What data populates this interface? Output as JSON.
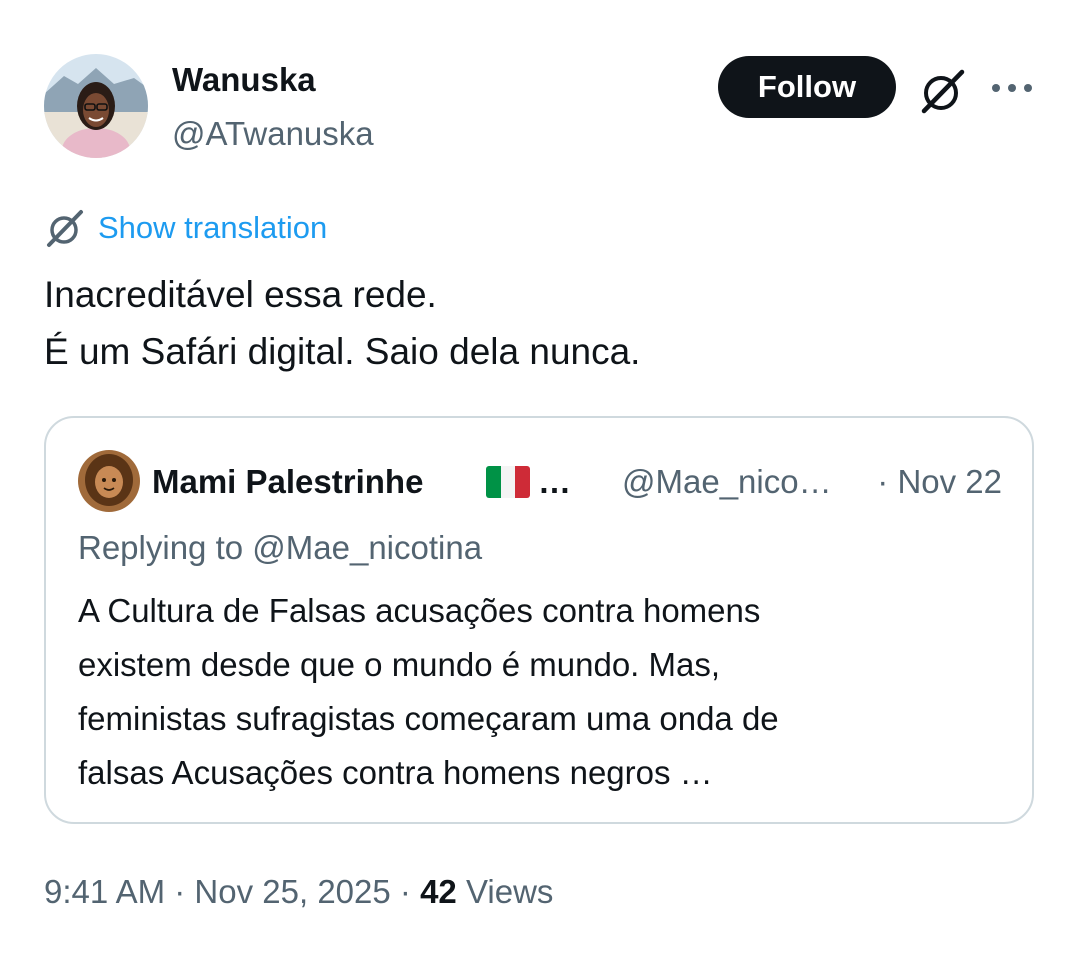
{
  "author": {
    "name": "Wanuska",
    "handle": "@ATwanuska",
    "avatar_icon": "profile-photo"
  },
  "actions": {
    "follow_label": "Follow",
    "grok_icon": "slashed-circle-icon",
    "more_icon": "more-dots-icon"
  },
  "translation": {
    "label": "Show translation",
    "icon": "slashed-circle-icon"
  },
  "tweet": {
    "lines": [
      "Inacreditável essa rede.",
      "É um Safári digital. Saio dela nunca."
    ]
  },
  "quoted_tweet": {
    "name": "Mami Palestrinhe",
    "name_ellipsis": "…",
    "flag": "italian-flag",
    "handle": "@Mae_nico…",
    "date": "· Nov 22",
    "replying_prefix": "Replying to",
    "replying_handle": "@Mae_nicotina",
    "lines": [
      "A Cultura de Falsas acusações contra homens",
      "existem desde que o mundo é mundo. Mas,",
      "feministas sufragistas começaram uma onda de",
      "falsas Acusações contra homens negros …"
    ]
  },
  "meta": {
    "time": "9:41 AM",
    "separator": "·",
    "date": "Nov 25, 2025",
    "views_count": "42",
    "views_label": "Views"
  },
  "colors": {
    "text": "#0f1419",
    "secondary": "#536471",
    "link": "#1d9bf0",
    "border": "#cfd9de",
    "button": "#0f1419",
    "flag_green": "#009246",
    "flag_white": "#ffffff",
    "flag_red": "#ce2b37"
  }
}
